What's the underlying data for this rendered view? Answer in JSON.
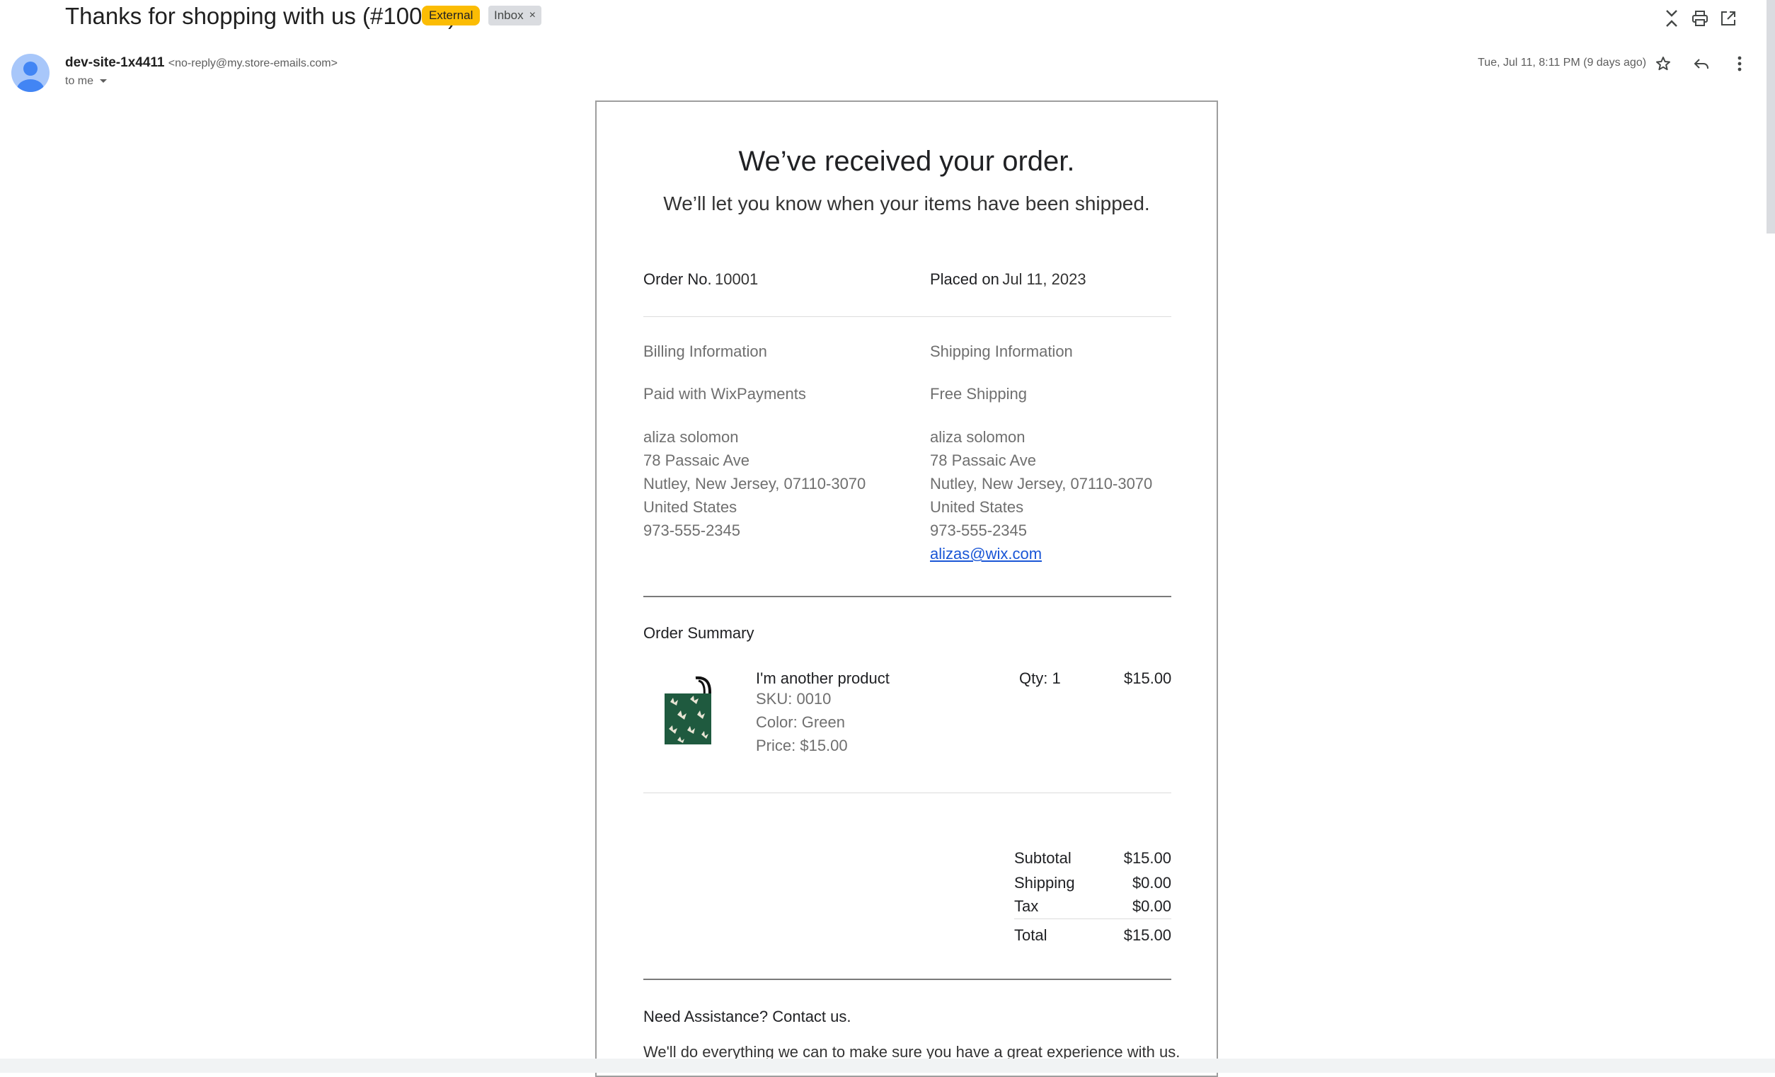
{
  "email": {
    "subject": "Thanks for shopping with us (#10001)",
    "badge_external": "External",
    "badge_inbox": "Inbox",
    "badge_close": "×",
    "sender_name": "dev-site-1x4411",
    "sender_email": "<no-reply@my.store-emails.com>",
    "to_me": "to me",
    "date": "Tue, Jul 11, 8:11 PM (9 days ago)"
  },
  "order": {
    "heading": "We’ve received your order.",
    "subheading": "We’ll let you know when your items have been shipped.",
    "order_no_label": "Order No.",
    "order_no": "10001",
    "placed_label": "Placed on",
    "placed_date": "Jul 11, 2023",
    "billing_title": "Billing Information",
    "billing_method": "Paid with WixPayments",
    "shipping_title": "Shipping Information",
    "shipping_method": "Free Shipping",
    "billing_address": [
      "aliza solomon",
      "78 Passaic Ave",
      "Nutley, New Jersey, 07110-3070",
      "United States",
      "973-555-2345"
    ],
    "shipping_address": [
      "aliza solomon",
      "78 Passaic Ave",
      "Nutley, New Jersey, 07110-3070",
      "United States",
      "973-555-2345"
    ],
    "shipping_email": "alizas@wix.com",
    "summary_title": "Order Summary",
    "item": {
      "name": "I'm another product",
      "sku": "SKU: 0010",
      "color": "Color: Green",
      "price": "Price: $15.00",
      "qty": "Qty: 1",
      "total": "$15.00"
    },
    "totals": [
      {
        "label": "Subtotal",
        "value": "$15.00"
      },
      {
        "label": "Shipping",
        "value": "$0.00"
      },
      {
        "label": "Tax",
        "value": "$0.00"
      }
    ],
    "total_label": "Total",
    "total_value": "$15.00",
    "assist_title": "Need Assistance? Contact us.",
    "assist_text": "We'll do everything we can to make sure you have a great experience with us."
  },
  "colors": {
    "external_badge": "#fbbc04",
    "link": "#1a56d6",
    "avatar": "#a8c7fa",
    "product_green": "#1f5a3f"
  }
}
